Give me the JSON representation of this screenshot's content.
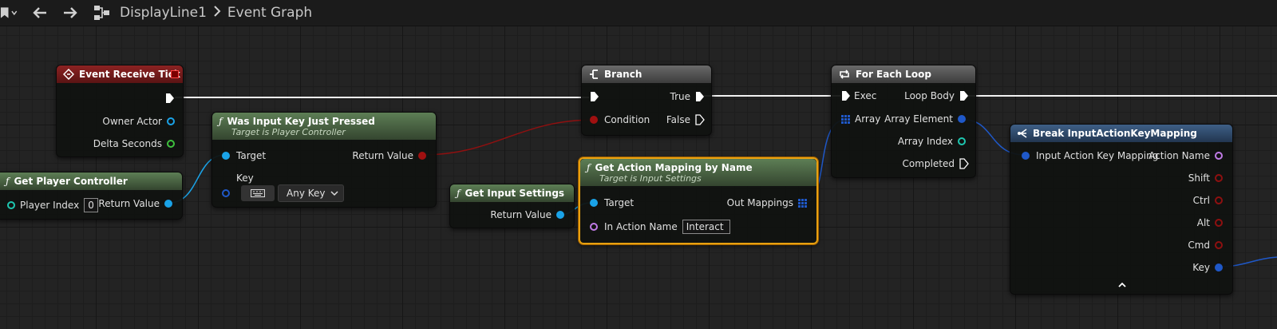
{
  "breadcrumb": {
    "blueprint": "DisplayLine1",
    "graph": "Event Graph"
  },
  "colors": {
    "exec": "#ffffff",
    "object": "#1aa3e8",
    "bool": "#8e1010",
    "float": "#3ec23e",
    "int": "#1ec7b0",
    "string": "#c07be6",
    "struct": "#1f58c8",
    "selection": "#e8a010"
  },
  "nodes": {
    "event_tick": {
      "title": "Event Receive Tick",
      "pins": {
        "owner": "Owner Actor",
        "delta": "Delta Seconds"
      }
    },
    "get_pc": {
      "title": "Get Player Controller",
      "player_index_label": "Player Index",
      "player_index_value": "0",
      "ret": "Return Value"
    },
    "was_input": {
      "title": "Was Input Key Just Pressed",
      "subtitle": "Target is Player Controller",
      "target": "Target",
      "key": "Key",
      "key_value": "Any Key",
      "ret": "Return Value"
    },
    "get_input": {
      "title": "Get Input Settings",
      "ret": "Return Value"
    },
    "branch": {
      "title": "Branch",
      "condition": "Condition",
      "true_label": "True",
      "false_label": "False"
    },
    "get_action": {
      "title": "Get Action Mapping by Name",
      "subtitle": "Target is Input Settings",
      "target": "Target",
      "in_action": "In Action Name",
      "in_action_value": "Interact",
      "out": "Out Mappings"
    },
    "foreach": {
      "title": "For Each Loop",
      "exec": "Exec",
      "array": "Array",
      "loop_body": "Loop Body",
      "array_element": "Array Element",
      "array_index": "Array Index",
      "completed": "Completed"
    },
    "break": {
      "title": "Break InputActionKeyMapping",
      "input": "Input Action Key Mapping",
      "outputs": [
        "Action Name",
        "Shift",
        "Ctrl",
        "Alt",
        "Cmd",
        "Key"
      ]
    }
  }
}
